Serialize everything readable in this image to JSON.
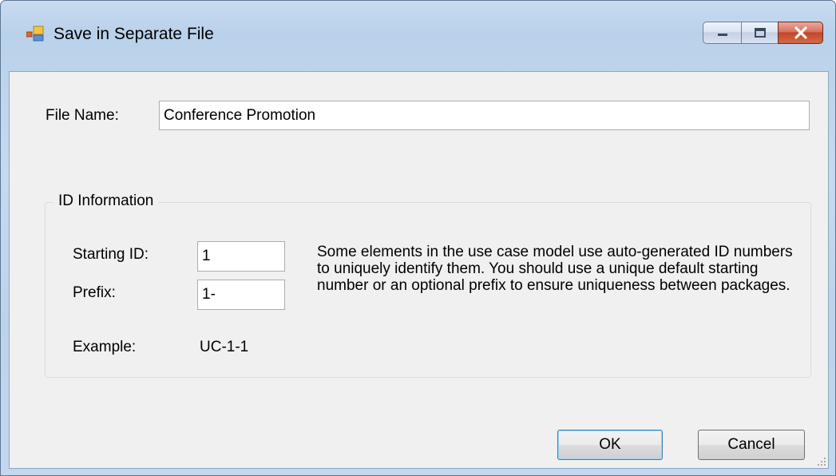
{
  "window": {
    "title": "Save in Separate File"
  },
  "form": {
    "file_name_label": "File Name:",
    "file_name_value": "Conference Promotion",
    "group_title": "ID Information",
    "starting_id_label": "Starting ID:",
    "starting_id_value": "1",
    "prefix_label": "Prefix:",
    "prefix_value": "1-",
    "example_label": "Example:",
    "example_value": "UC-1-1",
    "description": "Some elements in the use case model use auto-generated ID numbers to uniquely identify them. You should use a unique default starting number or an optional prefix to ensure uniqueness between packages."
  },
  "buttons": {
    "ok_label": "OK",
    "cancel_label": "Cancel"
  },
  "icons": {
    "app": "app-window-icon",
    "minimize": "minimize-icon",
    "maximize": "maximize-icon",
    "close": "close-icon",
    "grip": "resize-grip-icon"
  }
}
